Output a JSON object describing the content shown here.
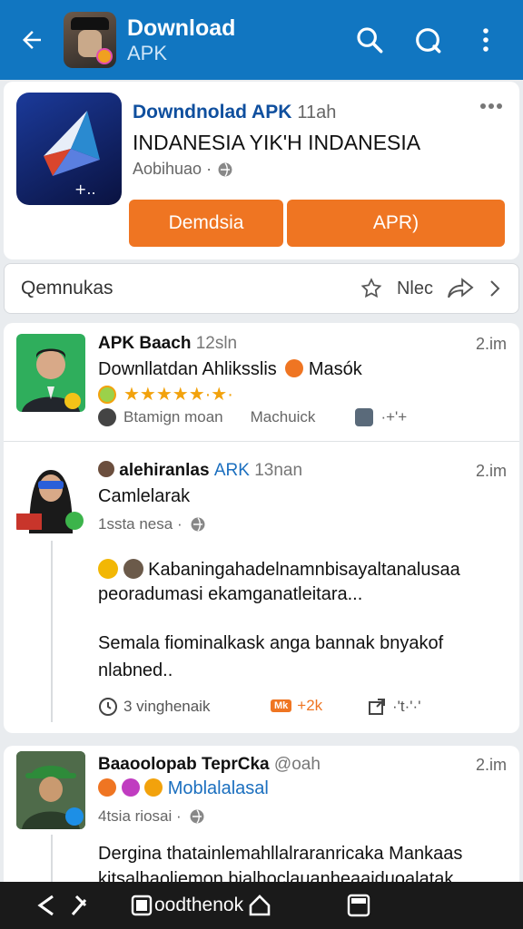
{
  "appbar": {
    "title": "Download",
    "subtitle": "APK",
    "icons": [
      "back-arrow-icon",
      "search-icon",
      "refresh-icon",
      "more-vert-icon"
    ]
  },
  "app_card": {
    "name": "Downdnolad APK",
    "time": "11ah",
    "headline": "INDANESIA YIK'H INDANESIA",
    "meta": "Aobihuao ·",
    "button_left": "Demdsia",
    "button_right": "APR)"
  },
  "action_row": {
    "label": "Qemnukas",
    "right_label": "Nlec"
  },
  "posts": [
    {
      "name": "APK Baach",
      "post_time_inline": "12sln",
      "time": "2.im",
      "text1": "Downllatdan Ahliksslis",
      "badge": "Masók",
      "rating_text": "★★★★★·★·",
      "meta_left": "Btamign moan",
      "meta_mid": "Machuick",
      "meta_right": "·+'+"
    },
    {
      "name": "alehiranlas",
      "handle": "ARK",
      "post_time_inline": "13nan",
      "time": "2.im",
      "subtitle": "Camlelarak",
      "meta": "1ssta nesa ·",
      "body1": "Kabaningahadelnamnbisayaltanalusaa",
      "body2": "peoradumasi ekamganatleitara...",
      "body3": "Semala fiominalkask anga bannak bnyakof",
      "body4": "nlabned..",
      "stat1": "3 vinghenaik",
      "stat2": "+2k",
      "stat2_pill": "Mk",
      "stat3": "·'t·'·'"
    },
    {
      "name": "Baaoolopab TeprCka",
      "handle": "@oah",
      "time": "2.im",
      "subtitle": "Moblalalasal",
      "meta": "4tsia riosai ·",
      "body1": "Dergina thatainlemahllalraranricaka Mankaas",
      "body2": "kitsalhaoliemon bialhoclauanheaaiduoalatak"
    }
  ],
  "bottom_nav": {
    "label": "oodthenok"
  },
  "colors": {
    "appbar": "#1176c1",
    "accent": "#ef7522",
    "link": "#1b6fbf"
  }
}
